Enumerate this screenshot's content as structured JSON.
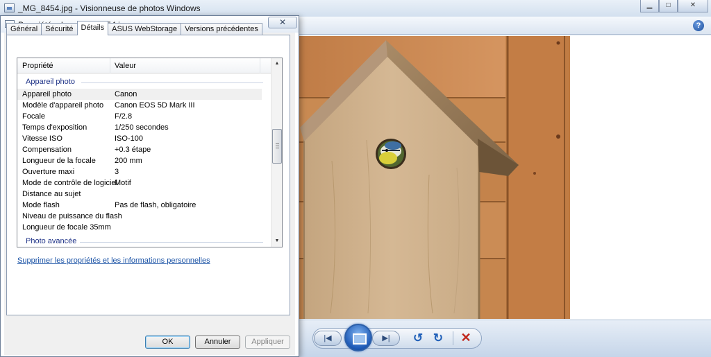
{
  "viewer": {
    "title": "_MG_8454.jpg - Visionneuse de photos Windows",
    "window_buttons": [
      "▁",
      "□",
      "✕"
    ],
    "help_glyph": "?",
    "controls": {
      "previous": "|◀",
      "next": "▶|",
      "rotate_ccw": "↺",
      "rotate_cw": "↻",
      "delete": "✕"
    }
  },
  "dialog": {
    "title": "Propriétés de : _MG_8454.jpg",
    "close_glyph": "✕",
    "tabs": [
      {
        "label": "Général",
        "active": false
      },
      {
        "label": "Sécurité",
        "active": false
      },
      {
        "label": "Détails",
        "active": true
      },
      {
        "label": "ASUS WebStorage",
        "active": false
      },
      {
        "label": "Versions précédentes",
        "active": false
      }
    ],
    "columns": {
      "property": "Propriété",
      "value": "Valeur"
    },
    "groups": {
      "camera": "Appareil photo",
      "advanced": "Photo avancée"
    },
    "rows": [
      {
        "key": "Appareil photo",
        "value": "Canon"
      },
      {
        "key": "Modèle d'appareil photo",
        "value": "Canon EOS 5D Mark III"
      },
      {
        "key": "Focale",
        "value": "F/2.8"
      },
      {
        "key": "Temps d'exposition",
        "value": "1/250 secondes"
      },
      {
        "key": "Vitesse ISO",
        "value": "ISO-100"
      },
      {
        "key": "Compensation",
        "value": "+0.3 étape"
      },
      {
        "key": "Longueur de la focale",
        "value": "200 mm"
      },
      {
        "key": "Ouverture maxi",
        "value": "3"
      },
      {
        "key": "Mode de contrôle de logiciel",
        "value": "Motif"
      },
      {
        "key": "Distance au sujet",
        "value": ""
      },
      {
        "key": "Mode flash",
        "value": "Pas de flash, obligatoire"
      },
      {
        "key": "Niveau de puissance du flash",
        "value": ""
      },
      {
        "key": "Longueur de focale 35mm",
        "value": ""
      }
    ],
    "scroll_up": "▲",
    "scroll_down": "▼",
    "remove_link": "Supprimer les propriétés et les informations personnelles",
    "buttons": {
      "ok": "OK",
      "cancel": "Annuler",
      "apply": "Appliquer"
    }
  }
}
